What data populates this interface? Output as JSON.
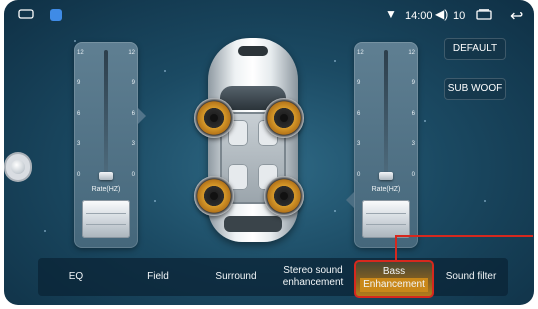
{
  "status_bar": {
    "time": "14:00",
    "volume": "10",
    "icons": [
      "home-icon",
      "app-icon",
      "wifi-icon",
      "volume-icon",
      "recent-apps-icon",
      "back-icon"
    ]
  },
  "left_panel": {
    "scale_labels": [
      "12",
      "9",
      "6",
      "3",
      "0"
    ],
    "rate_label": "Rate(HZ)",
    "level": 0
  },
  "right_panel": {
    "scale_labels": [
      "12",
      "9",
      "6",
      "3",
      "0"
    ],
    "rate_label": "Rate(HZ)",
    "level": 0
  },
  "buttons": {
    "default_label": "DEFAULT",
    "subwoof_label": "SUB WOOF"
  },
  "tabs": [
    {
      "label": "EQ"
    },
    {
      "label": "Field"
    },
    {
      "label": "Surround"
    },
    {
      "label": "Stereo sound",
      "label2": "enhancement"
    },
    {
      "label": "Bass",
      "label2": "Enhancement",
      "active": true
    },
    {
      "label": "Sound filter"
    }
  ],
  "colors": {
    "accent_active": "#b27d1c",
    "highlight_border": "#d6281e",
    "speaker_cone": "#d79a2a"
  }
}
